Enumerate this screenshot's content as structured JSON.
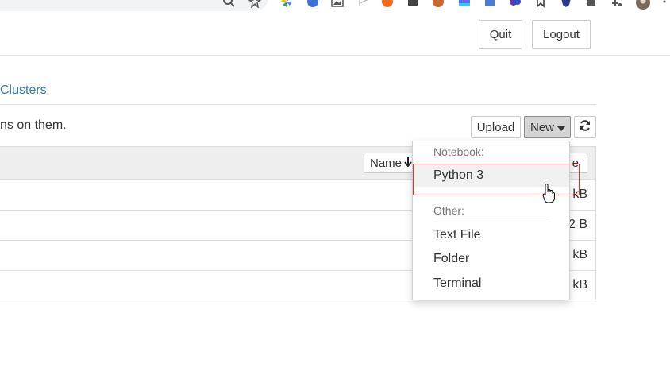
{
  "header": {
    "quit_label": "Quit",
    "logout_label": "Logout"
  },
  "tabs": {
    "clusters_label": "Clusters"
  },
  "toolbar": {
    "hint_text": "ns on them.",
    "upload_label": "Upload",
    "new_label": "New",
    "refresh_icon": "refresh-icon"
  },
  "list": {
    "sort_label": "Name",
    "column_partial": "e",
    "rows": [
      {
        "size": "kB"
      },
      {
        "size": "2 B"
      },
      {
        "size": "kB"
      },
      {
        "size": "kB"
      }
    ]
  },
  "new_menu": {
    "notebook_header": "Notebook:",
    "python_label": "Python 3",
    "other_header": "Other:",
    "text_file_label": "Text File",
    "folder_label": "Folder",
    "terminal_label": "Terminal"
  },
  "colors": {
    "link": "#337ab7",
    "highlight": "#e0352b",
    "new_button_bg": "#d4d4d4"
  }
}
